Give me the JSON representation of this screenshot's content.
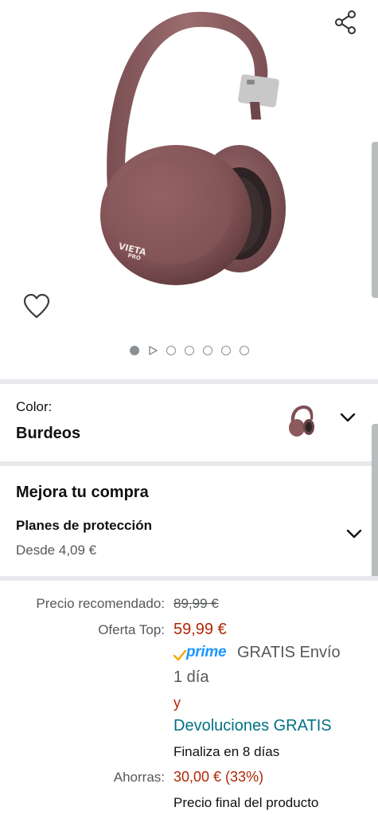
{
  "product": {
    "image_alt": "Burgundy over-ear headphones",
    "brand_mark": "VIETA PRO",
    "carousel": {
      "total": 7,
      "active_index": 0,
      "video_index": 1
    }
  },
  "color": {
    "label": "Color:",
    "selected": "Burdeos"
  },
  "upgrade": {
    "title": "Mejora tu compra",
    "subtitle": "Planes de protección",
    "from_price": "Desde 4,09 €"
  },
  "pricing": {
    "recommended_label": "Precio recomendado:",
    "recommended_price": "89,99 €",
    "offer_label": "Oferta Top:",
    "offer_price": "59,99 €",
    "prime_label": "prime",
    "shipping_line1": "GRATIS Envío",
    "shipping_line2": "1 día",
    "and_text": "y",
    "returns_link": "Devoluciones GRATIS",
    "ends_text": "Finaliza en 8 días",
    "savings_label": "Ahorras:",
    "savings_value": "30,00 € (33%)",
    "final_price_text": "Precio final del producto"
  },
  "icons": {
    "share": "share-icon",
    "wishlist": "heart-outline-icon",
    "expand": "chevron-down-icon",
    "prime_check": "prime-check-icon"
  },
  "colors": {
    "price_red": "#b12704",
    "link_teal": "#007185",
    "prime_blue": "#1a98ff",
    "headphone": "#8a5a5c",
    "divider": "#e7e9ec"
  }
}
